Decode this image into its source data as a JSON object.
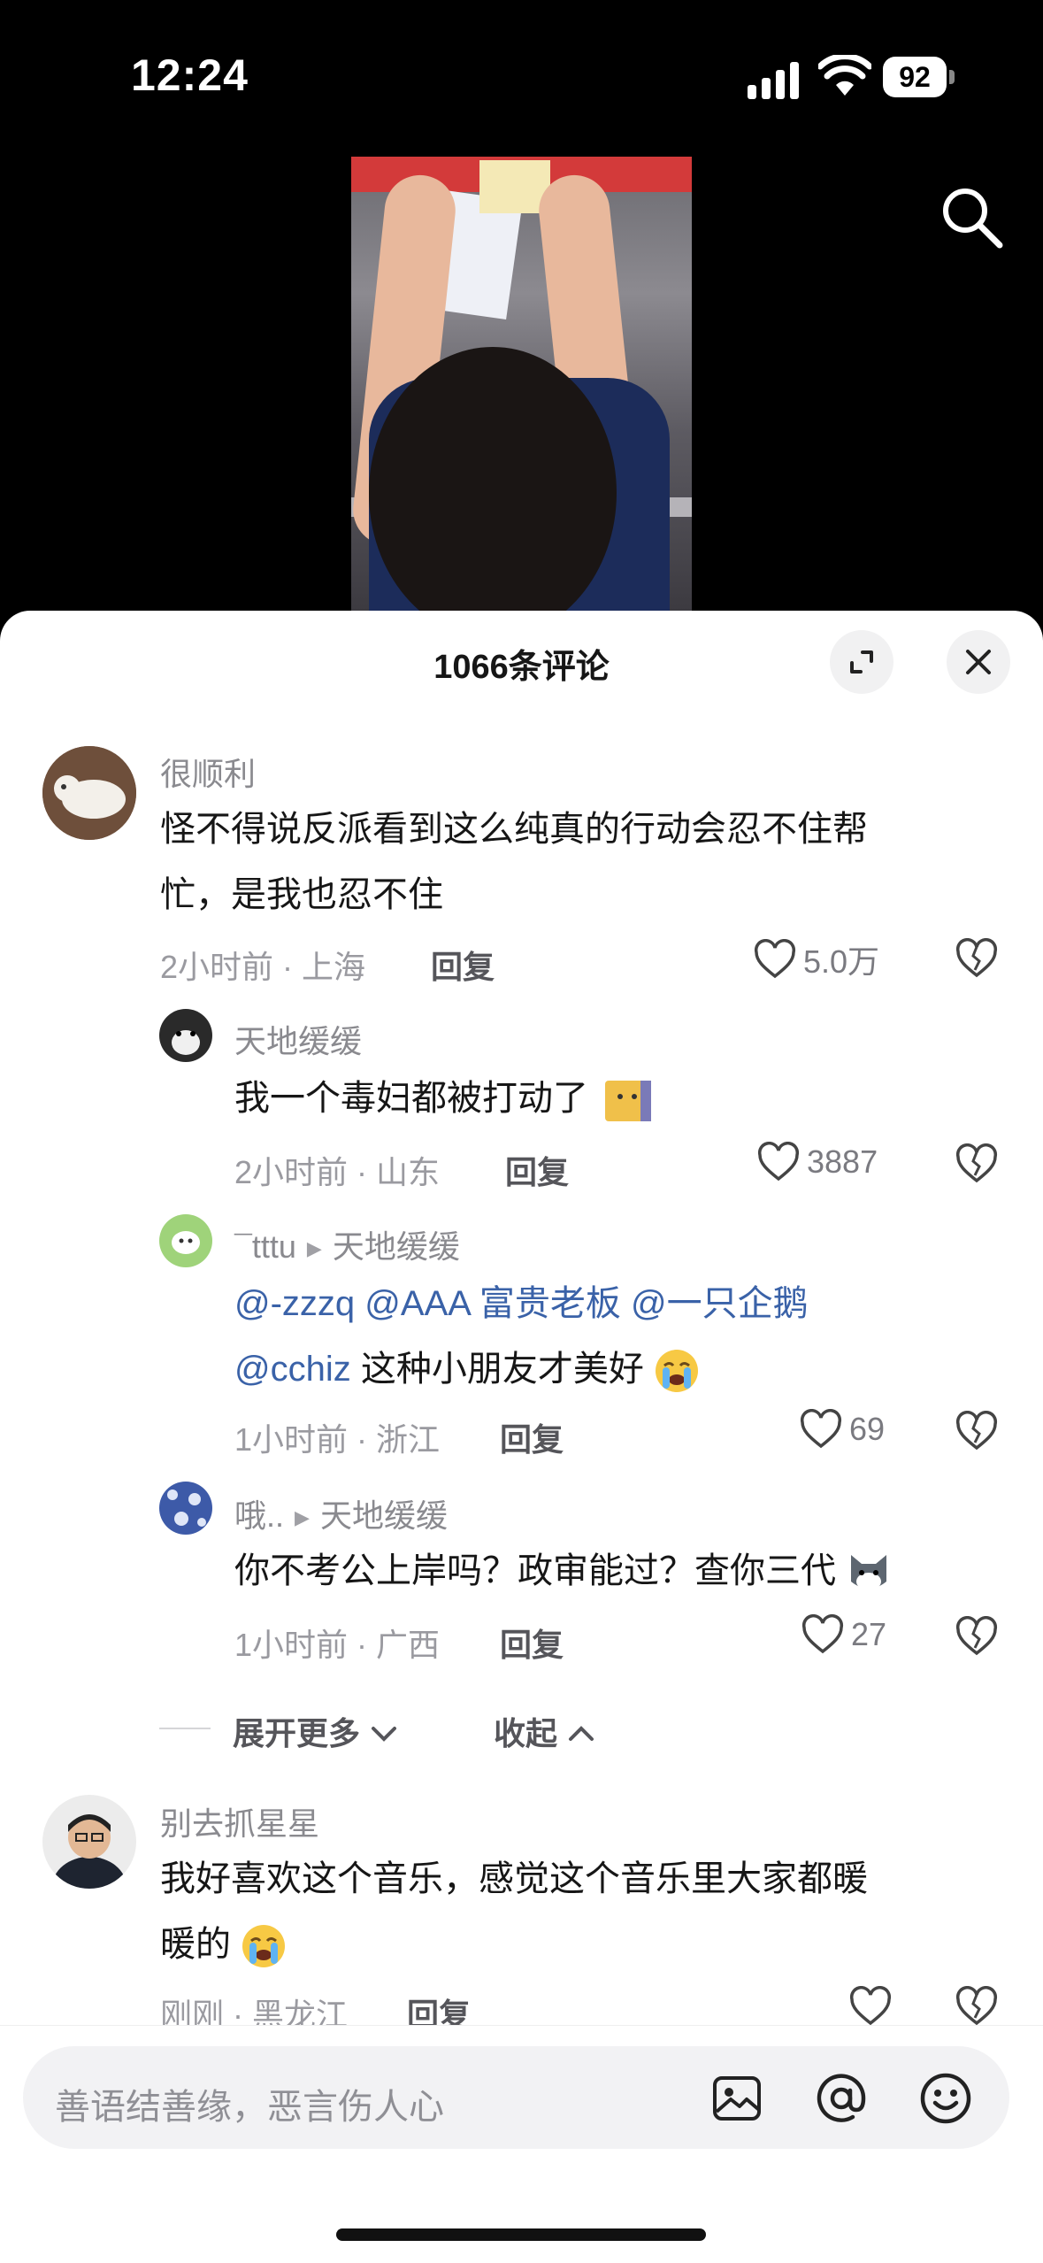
{
  "status_bar": {
    "time": "12:24",
    "battery": "92"
  },
  "sheet": {
    "title": "1066条评论"
  },
  "comments": [
    {
      "user": "很顺利",
      "line1": "怪不得说反派看到这么纯真的行动会忍不住帮",
      "line2": "忙，是我也忍不住",
      "meta": "2小时前 · 上海",
      "reply": "回复",
      "likes": "5.0万"
    }
  ],
  "replies": [
    {
      "user": "天地缓缓",
      "text": "我一个毒妇都被打动了",
      "meta": "2小时前 · 山东",
      "reply": "回复",
      "likes": "3887"
    },
    {
      "user": "¯tttu",
      "reply_to": "天地缓缓",
      "mentions": [
        "@-zzzq",
        "@AAA 富贵老板",
        "@一只企鹅",
        "@cchiz"
      ],
      "text": "这种小朋友才美好",
      "meta": "1小时前 · 浙江",
      "reply": "回复",
      "likes": "69"
    },
    {
      "user": "哦..",
      "reply_to": "天地缓缓",
      "text": "你不考公上岸吗？政审能过？查你三代",
      "meta": "1小时前 · 广西",
      "reply": "回复",
      "likes": "27"
    }
  ],
  "expand": {
    "more": "展开更多",
    "less": "收起"
  },
  "comment2": {
    "user": "别去抓星星",
    "line1": "我好喜欢这个音乐，感觉这个音乐里大家都暖",
    "line2": "暖的",
    "meta": "刚刚 · 黑龙江",
    "reply": "回复"
  },
  "input": {
    "placeholder": "善语结善缘，恶言伤人心"
  },
  "icons": [
    "search-icon",
    "expand-icon",
    "close-icon",
    "heart-icon",
    "broken-heart-icon",
    "image-icon",
    "at-icon",
    "emoji-icon"
  ]
}
